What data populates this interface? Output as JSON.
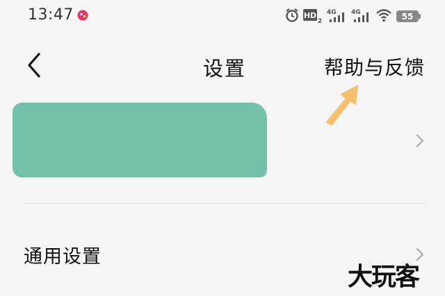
{
  "status_bar": {
    "time": "13:47",
    "battery": "55",
    "icons": [
      "app-notification-icon",
      "alarm-icon",
      "hd-volte-icon",
      "signal-4g-icon",
      "signal-4g-icon",
      "wifi-icon",
      "battery-icon"
    ]
  },
  "header": {
    "title": "设置",
    "help_label": "帮助与反馈"
  },
  "account": {
    "redacted": true
  },
  "rows": {
    "general_settings": "通用设置"
  },
  "annotation": {
    "arrow_color": "#f5c06b"
  },
  "watermark": "大玩客",
  "colors": {
    "background": "#f5f5f5",
    "redaction": "#73c1ab",
    "chevron": "#b0b0b0"
  }
}
